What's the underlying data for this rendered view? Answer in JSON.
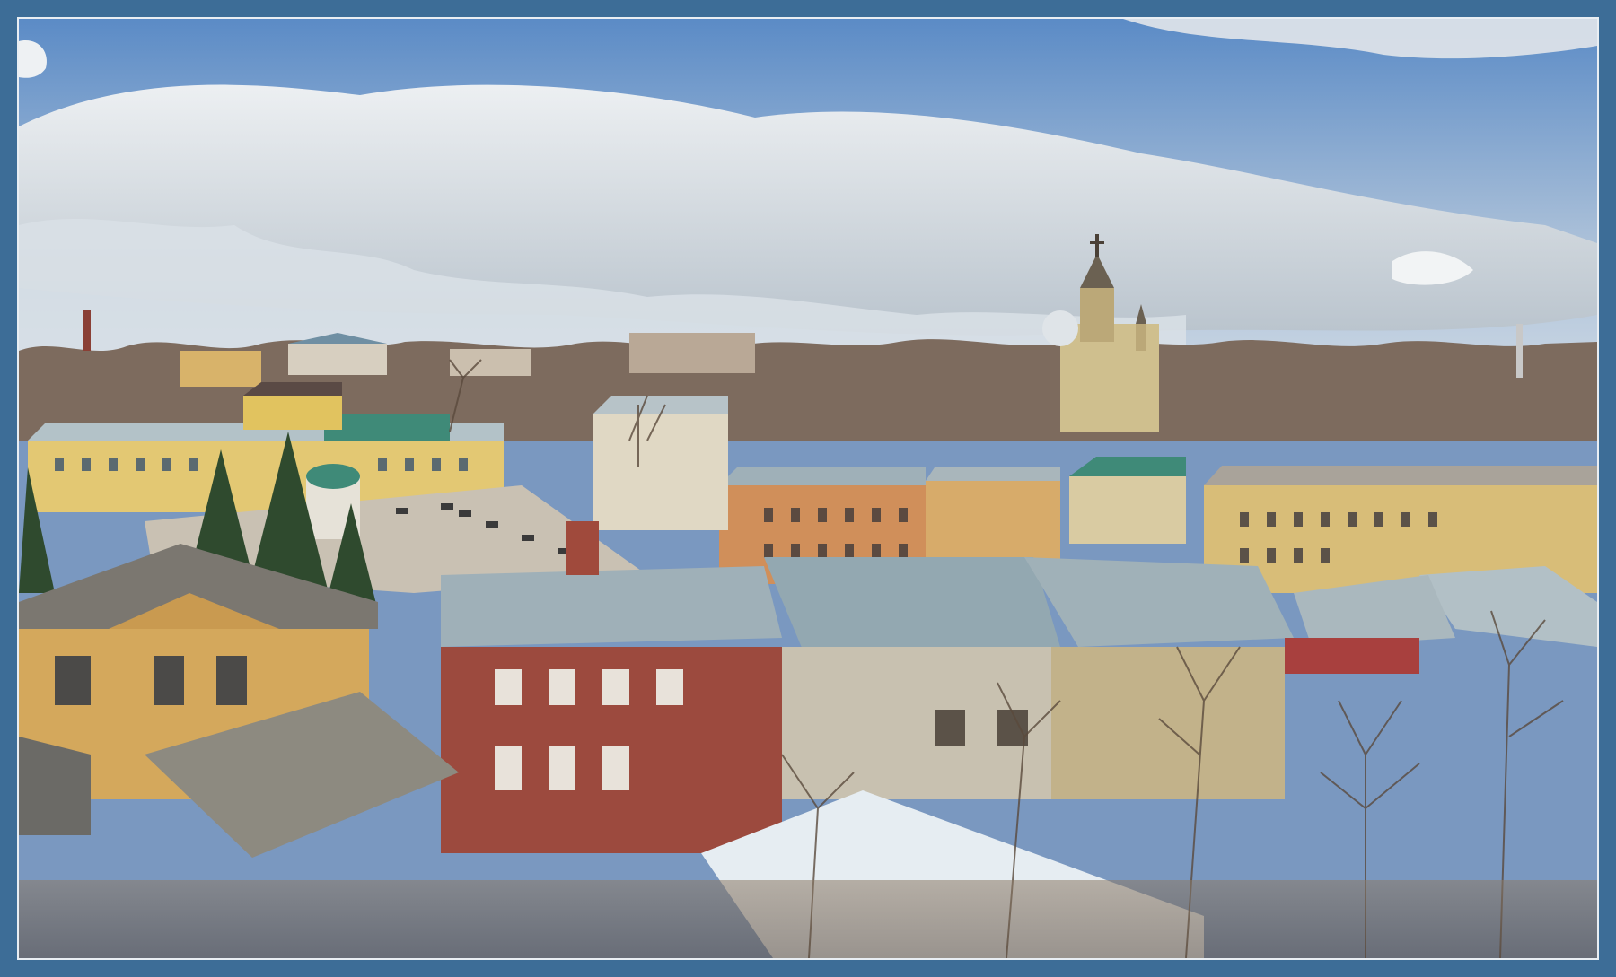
{
  "photo": {
    "subject": "town-panorama",
    "palette": {
      "frame": "#3d6d97",
      "frame_inner_border": "#e9eef3",
      "sky_top": "#5f8fc8",
      "sky_bottom": "#c9d6e4",
      "cloud": "#eef1f3",
      "roof_metal": "#9fb0b8",
      "brick": "#9c4a3e",
      "ochre_wall": "#d4a85c",
      "yellow_wall": "#e3c873",
      "trees": "#6b5a4a",
      "pine": "#2f4a2e"
    }
  }
}
